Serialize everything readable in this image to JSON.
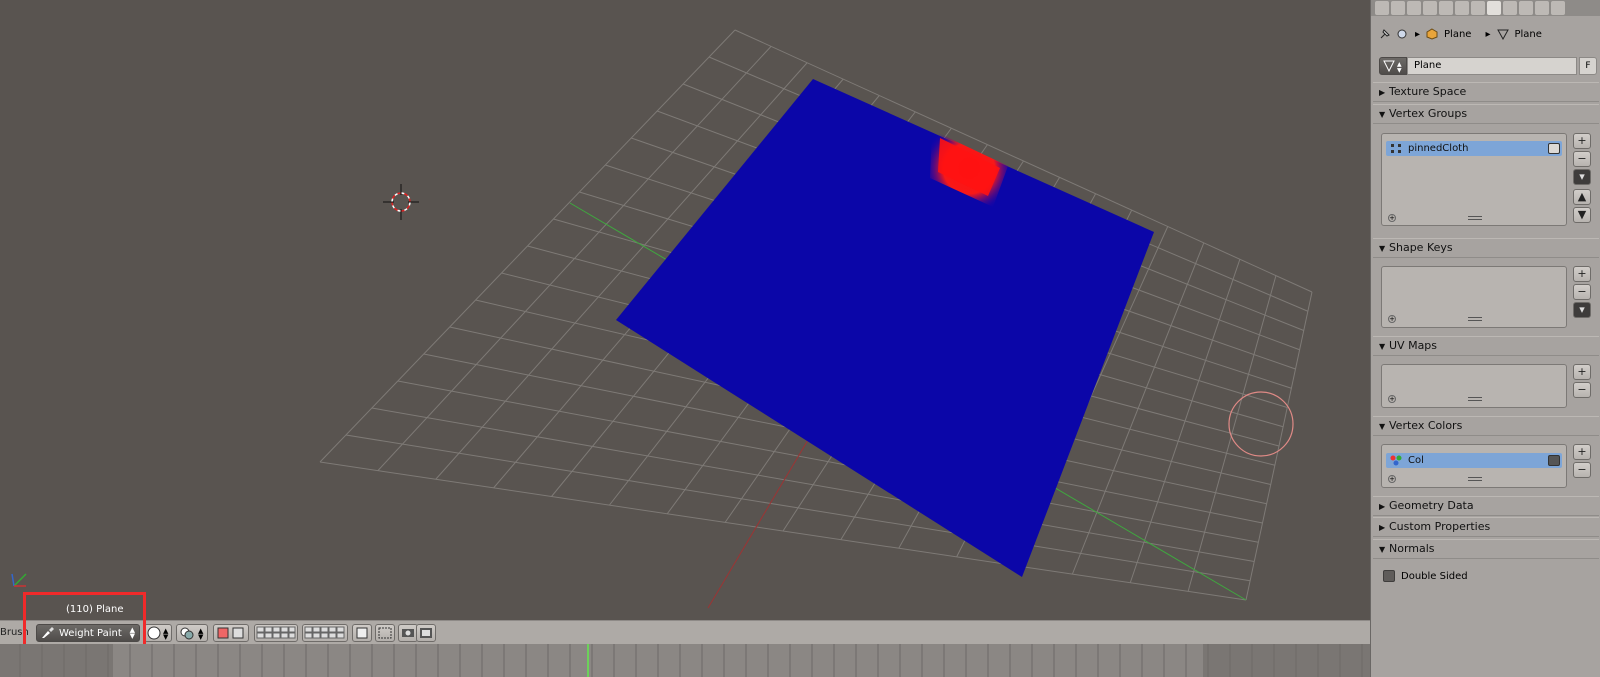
{
  "viewport": {
    "object_label": "(110) Plane"
  },
  "header": {
    "brush_label": "Brush",
    "mode": "Weight Paint",
    "mode_icon": "weight-paint-icon"
  },
  "properties": {
    "breadcrumb": {
      "object": "Plane",
      "mesh": "Plane"
    },
    "mesh_name": "Plane",
    "fake_user": "F",
    "sections": {
      "texture_space": "Texture Space",
      "vertex_groups": "Vertex Groups",
      "shape_keys": "Shape Keys",
      "uv_maps": "UV Maps",
      "vertex_colors": "Vertex Colors",
      "geometry_data": "Geometry Data",
      "custom_properties": "Custom Properties",
      "normals": "Normals"
    },
    "vertex_groups": [
      "pinnedCloth"
    ],
    "vertex_colors": [
      "Col"
    ],
    "double_sided": "Double Sided",
    "add": "+",
    "remove": "−",
    "menu": "▾",
    "up": "▲",
    "down": "▼"
  }
}
